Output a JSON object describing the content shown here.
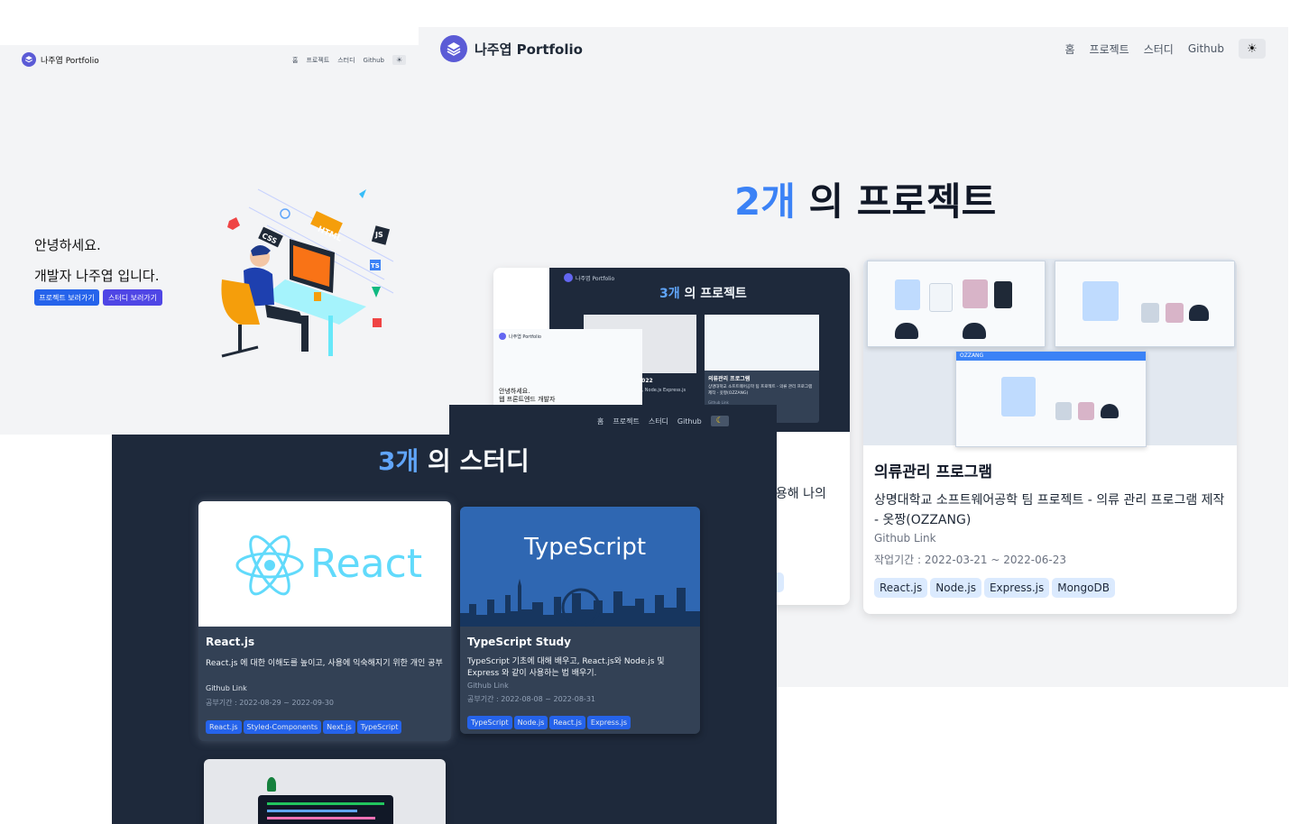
{
  "projects_page": {
    "brand": "나주엽 Portfolio",
    "nav": [
      "홈",
      "프로젝트",
      "스터디",
      "Github"
    ],
    "theme_icon": "☀",
    "heading_count": "2개",
    "heading_rest": " 의 프로젝트",
    "card_left": {
      "partial_desc": "이용해 나의",
      "partial_tag": "s",
      "thumb_inner": {
        "brand": "나주엽 Portfolio",
        "heading_count": "3개",
        "heading_rest": " 의 프로젝트",
        "hero_line1": "안녕하세요.",
        "hero_line2": "웹 프론트엔드 개발자",
        "card_year": "2022",
        "card_stack": "고, Node.js Express.js",
        "card2_title": "의류관리 프로그램",
        "card2_desc": "상명대학교 소프트웨어공학 팀 프로젝트 - 의류 관리 프로그램 제작 - 옷짱(OZZANG)",
        "card2_link": "Github Link"
      }
    },
    "card_right": {
      "title": "의류관리 프로그램",
      "desc": "상명대학교 소프트웨어공학 팀 프로젝트 - 의류 관리 프로그램 제작 - 옷짱(OZZANG)",
      "link": "Github Link",
      "period": "작업기간 : 2022-03-21 ~ 2022-06-23",
      "tags": [
        "React.js",
        "Node.js",
        "Express.js",
        "MongoDB"
      ],
      "thumb_app_name": "OZZANG"
    }
  },
  "hero_page": {
    "brand": "나주엽 Portfolio",
    "nav": [
      "홈",
      "프로젝트",
      "스터디",
      "Github"
    ],
    "theme_icon": "☀",
    "greeting": "안녕하세요.",
    "intro": "개발자 나주엽 입니다.",
    "btn_projects": "프로젝트 보러가기",
    "btn_study": "스터디 보러가기",
    "illustration_labels": [
      "HTML",
      "CSS",
      "JS",
      "TS"
    ]
  },
  "study_page": {
    "nav": [
      "홈",
      "프로젝트",
      "스터디",
      "Github"
    ],
    "theme_icon": "☾",
    "heading_count": "3개",
    "heading_rest": " 의 스터디",
    "cards": [
      {
        "thumb_text": "React",
        "title": "React.js",
        "desc": "React.js 에 대한 이해도를 높이고, 사용에 익숙해지기 위한 개인 공부",
        "link": "Github Link",
        "period": "공부기간 : 2022-08-29 ~ 2022-09-30",
        "tags": [
          "React.js",
          "Styled-Components",
          "Next.js",
          "TypeScript"
        ]
      },
      {
        "thumb_text": "TypeScript",
        "title": "TypeScript Study",
        "desc": "TypeScript 기초에 대해 배우고, React.js와 Node.js 및 Express 와 같이 사용하는 법 배우기.",
        "link": "Github Link",
        "period": "공부기간 : 2022-08-08 ~ 2022-08-31",
        "tags": [
          "TypeScript",
          "Node.js",
          "React.js",
          "Express.js"
        ]
      }
    ]
  },
  "colors": {
    "accent": "#3b82f6",
    "button_blue": "#2563eb",
    "button_indigo": "#4f46e5",
    "dark_bg": "#1e293b",
    "light_bg": "#f3f4f6",
    "tag_light": "#dbeafe"
  }
}
